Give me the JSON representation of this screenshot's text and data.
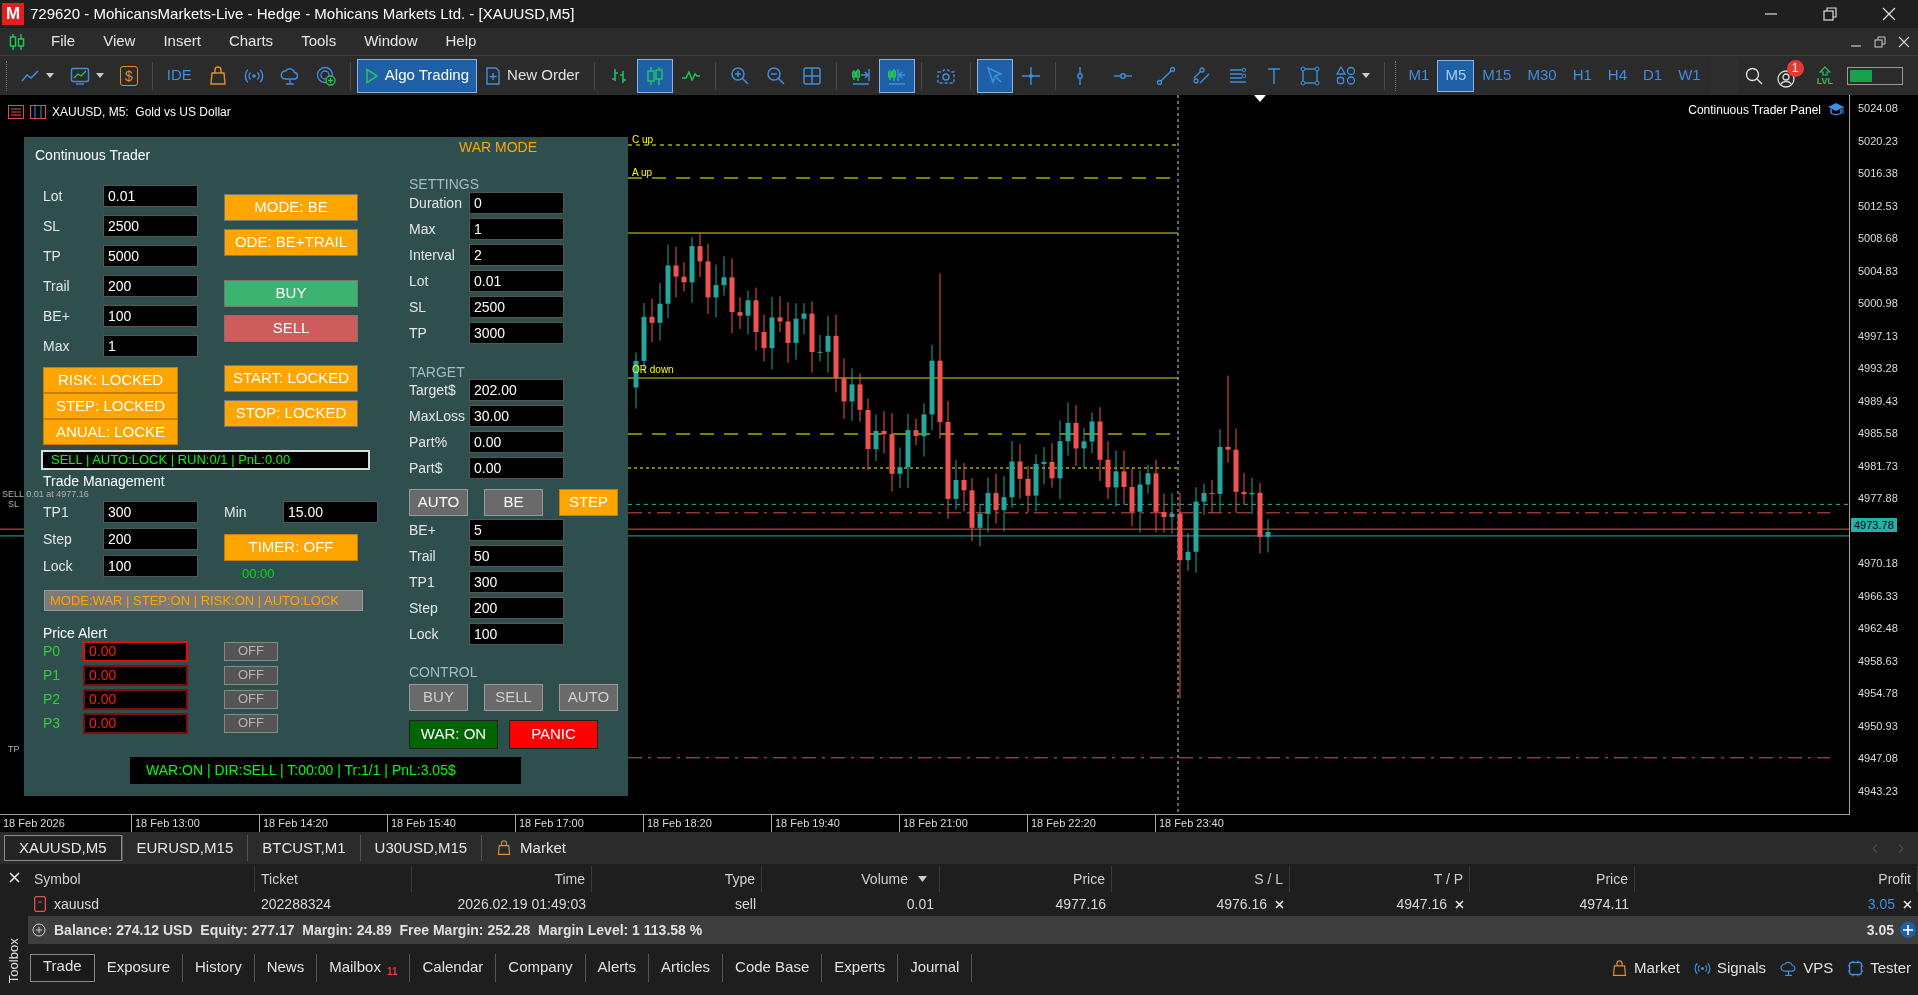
{
  "window": {
    "logo": "M",
    "title": "729620 - MohicansMarkets-Live - Hedge - Mohicans Markets Ltd. - [XAUUSD,M5]"
  },
  "menu": [
    "File",
    "View",
    "Insert",
    "Charts",
    "Tools",
    "Window",
    "Help"
  ],
  "toolbar": {
    "buttons": [
      {
        "kind": "line",
        "selected": false
      },
      {
        "kind": "chart-window",
        "selected": false
      },
      {
        "kind": "boxed",
        "label": "$",
        "selected": false
      },
      {
        "kind": "sep"
      },
      {
        "kind": "text",
        "label": "IDE",
        "selected": false
      },
      {
        "kind": "bag",
        "selected": false
      },
      {
        "kind": "signal",
        "selected": false
      },
      {
        "kind": "cloud",
        "selected": false
      },
      {
        "kind": "radar",
        "selected": false
      },
      {
        "kind": "sep"
      },
      {
        "kind": "algo",
        "label": "Algo Trading",
        "selected": true
      },
      {
        "kind": "order",
        "label": "New Order",
        "selected": false
      },
      {
        "kind": "sep"
      },
      {
        "kind": "bars",
        "selected": false
      },
      {
        "kind": "candles",
        "selected": true
      },
      {
        "kind": "linechart",
        "selected": false
      },
      {
        "kind": "sep"
      },
      {
        "kind": "zoom-in",
        "selected": false
      },
      {
        "kind": "zoom-out",
        "selected": false
      },
      {
        "kind": "grid",
        "selected": false
      },
      {
        "kind": "sep"
      },
      {
        "kind": "autoscroll",
        "selected": false
      },
      {
        "kind": "shift",
        "selected": true
      },
      {
        "kind": "sep"
      },
      {
        "kind": "camera",
        "selected": false
      },
      {
        "kind": "sep"
      },
      {
        "kind": "cursor",
        "selected": true
      },
      {
        "kind": "crosshair",
        "selected": false
      },
      {
        "kind": "sep"
      },
      {
        "kind": "vline",
        "selected": false
      },
      {
        "kind": "hline",
        "selected": false
      },
      {
        "kind": "trend",
        "selected": false
      },
      {
        "kind": "channel",
        "selected": false
      },
      {
        "kind": "fibo",
        "selected": false
      },
      {
        "kind": "texttool",
        "selected": false
      },
      {
        "kind": "rect",
        "selected": false
      },
      {
        "kind": "shapes",
        "selected": false
      },
      {
        "kind": "sep"
      }
    ],
    "timeframes": [
      {
        "label": "M1",
        "selected": false
      },
      {
        "label": "M5",
        "selected": true
      },
      {
        "label": "M15",
        "selected": false
      },
      {
        "label": "M30",
        "selected": false
      },
      {
        "label": "H1",
        "selected": false
      },
      {
        "label": "H4",
        "selected": false
      },
      {
        "label": "D1",
        "selected": false
      },
      {
        "label": "W1",
        "selected": false
      }
    ],
    "notification_count": "1",
    "lvl_label": "LVL"
  },
  "chart": {
    "title": "XAUUSD, M5:  Gold vs US Dollar",
    "panel_caption": "Continuous Trader Panel",
    "line_labels": [
      {
        "label": "C up",
        "kind": "level"
      },
      {
        "label": "A up",
        "kind": "level"
      },
      {
        "label": "OR down",
        "kind": "level"
      },
      {
        "label": "SELL 0.01 at 4977.16",
        "kind": "trade"
      },
      {
        "label": "SL",
        "kind": "trade"
      },
      {
        "label": "TP",
        "kind": "trade"
      }
    ],
    "price_axis": [
      "5024.08",
      "5020.23",
      "5016.38",
      "5012.53",
      "5008.68",
      "5004.83",
      "5000.98",
      "4997.13",
      "4993.28",
      "4989.43",
      "4985.58",
      "4981.73",
      "4977.88",
      "4970.18",
      "4966.33",
      "4962.48",
      "4958.63",
      "4954.78",
      "4950.93",
      "4947.08",
      "4943.23"
    ],
    "price_tag": "4973.78",
    "time_axis": [
      "18 Feb 2026",
      "18 Feb 13:00",
      "18 Feb 14:20",
      "18 Feb 15:40",
      "18 Feb 17:00",
      "18 Feb 18:20",
      "18 Feb 19:40",
      "18 Feb 21:00",
      "18 Feb 22:20",
      "18 Feb 23:40"
    ]
  },
  "panel": {
    "title": "Continuous Trader",
    "mode_banner": "WAR MODE",
    "fields": [
      {
        "label": "Lot",
        "value": "0.01"
      },
      {
        "label": "SL",
        "value": "2500"
      },
      {
        "label": "TP",
        "value": "5000"
      },
      {
        "label": "Trail",
        "value": "200"
      },
      {
        "label": "BE+",
        "value": "100"
      },
      {
        "label": "Max",
        "value": "1"
      }
    ],
    "locks": [
      "RISK: LOCKED",
      "STEP: LOCKED",
      "ANUAL: LOCKE"
    ],
    "actions": [
      {
        "label": "MODE: BE",
        "color": "#ffa500"
      },
      {
        "label": "ODE: BE+TRAIL",
        "color": "#ffa500"
      },
      {
        "label": "BUY",
        "color": "#3cb371"
      },
      {
        "label": "SELL",
        "color": "#cd5c5c"
      },
      {
        "label": "START: LOCKED",
        "color": "#ffa500"
      },
      {
        "label": "STOP: LOCKED",
        "color": "#ffa500"
      }
    ],
    "run_status": "SELL | AUTO:LOCK | RUN:0/1 | PnL:0.00",
    "trade_management": {
      "title": "Trade Management",
      "fields": [
        {
          "label": "TP1",
          "value": "300"
        },
        {
          "label": "Step",
          "value": "200"
        },
        {
          "label": "Lock",
          "value": "100"
        }
      ],
      "min": {
        "label": "Min",
        "value": "15.00"
      },
      "timer_button": "TIMER: OFF",
      "timer": "00:00"
    },
    "mode_status": "MODE:WAR | STEP:ON | RISK:ON | AUTO:LOCK",
    "price_alert": {
      "title": "Price Alert",
      "rows": [
        {
          "label": "P0",
          "value": "0.00",
          "toggle": "OFF",
          "selected": true
        },
        {
          "label": "P1",
          "value": "0.00",
          "toggle": "OFF",
          "selected": false
        },
        {
          "label": "P2",
          "value": "0.00",
          "toggle": "OFF",
          "selected": false
        },
        {
          "label": "P3",
          "value": "0.00",
          "toggle": "OFF",
          "selected": false
        }
      ]
    },
    "settings": {
      "title": "SETTINGS",
      "fields": [
        {
          "label": "Duration",
          "value": "0"
        },
        {
          "label": "Max",
          "value": "1"
        },
        {
          "label": "Interval",
          "value": "2"
        },
        {
          "label": "Lot",
          "value": "0.01"
        },
        {
          "label": "SL",
          "value": "2500"
        },
        {
          "label": "TP",
          "value": "3000"
        }
      ]
    },
    "target": {
      "title": "TARGET",
      "fields": [
        {
          "label": "Target$",
          "value": "202.00"
        },
        {
          "label": "MaxLoss",
          "value": "30.00"
        },
        {
          "label": "Part%",
          "value": "0.00"
        },
        {
          "label": "Part$",
          "value": "0.00"
        }
      ]
    },
    "modes": [
      {
        "label": "AUTO",
        "selected": false
      },
      {
        "label": "BE",
        "selected": false
      },
      {
        "label": "STEP",
        "selected": true
      }
    ],
    "step_fields": [
      {
        "label": "BE+",
        "value": "5"
      },
      {
        "label": "Trail",
        "value": "50"
      },
      {
        "label": "TP1",
        "value": "300"
      },
      {
        "label": "Step",
        "value": "200"
      },
      {
        "label": "Lock",
        "value": "100"
      }
    ],
    "control": {
      "title": "CONTROL",
      "buttons": [
        "BUY",
        "SELL",
        "AUTO"
      ],
      "actions": [
        {
          "label": "WAR: ON",
          "color": "#006400"
        },
        {
          "label": "PANIC",
          "color": "#ff0000"
        }
      ]
    },
    "status": "WAR:ON | DIR:SELL | T:00:00 | Tr:1/1 | PnL:3.05$"
  },
  "symbol_tabs": [
    {
      "label": "XAUUSD,M5",
      "kind": "chart",
      "selected": true
    },
    {
      "label": "EURUSD,M15",
      "kind": "chart",
      "selected": false
    },
    {
      "label": "BTCUST,M1",
      "kind": "chart",
      "selected": false
    },
    {
      "label": "U30USD,M15",
      "kind": "chart",
      "selected": false
    },
    {
      "label": "Market",
      "kind": "market",
      "selected": false
    }
  ],
  "toolbox": {
    "title": "Toolbox",
    "columns": [
      {
        "label": "Symbol",
        "sorted": false
      },
      {
        "label": "Ticket",
        "sorted": false
      },
      {
        "label": "Time",
        "sorted": false
      },
      {
        "label": "Type",
        "sorted": false
      },
      {
        "label": "Volume",
        "sorted": true
      },
      {
        "label": "Price",
        "sorted": false
      },
      {
        "label": "S / L",
        "sorted": false
      },
      {
        "label": "T / P",
        "sorted": false
      },
      {
        "label": "Price",
        "sorted": false
      },
      {
        "label": "Profit",
        "sorted": false
      }
    ],
    "rows": [
      {
        "cells": [
          "xauusd",
          "202288324",
          "2026.02.19 01:49:03",
          "sell",
          "0.01",
          "4977.16",
          "4976.16",
          "4947.16",
          "4974.11",
          "3.05"
        ]
      }
    ],
    "balance": "Balance: 274.12 USD  Equity: 277.17  Margin: 24.89  Free Margin: 252.28  Margin Level: 1 113.58 %",
    "total": "3.05",
    "tabs": [
      {
        "label": "Trade",
        "selected": true
      },
      {
        "label": "Exposure",
        "selected": false
      },
      {
        "label": "History",
        "selected": false
      },
      {
        "label": "News",
        "selected": false
      },
      {
        "label": "Mailbox",
        "selected": false,
        "badge": "11"
      },
      {
        "label": "Calendar",
        "selected": false
      },
      {
        "label": "Company",
        "selected": false
      },
      {
        "label": "Alerts",
        "selected": false
      },
      {
        "label": "Articles",
        "selected": false
      },
      {
        "label": "Code Base",
        "selected": false
      },
      {
        "label": "Experts",
        "selected": false
      },
      {
        "label": "Journal",
        "selected": false
      }
    ],
    "services": [
      {
        "label": "Market",
        "kind": "market"
      },
      {
        "label": "Signals",
        "kind": "signals"
      },
      {
        "label": "VPS",
        "kind": "vps"
      },
      {
        "label": "Tester",
        "kind": "tester"
      }
    ]
  }
}
